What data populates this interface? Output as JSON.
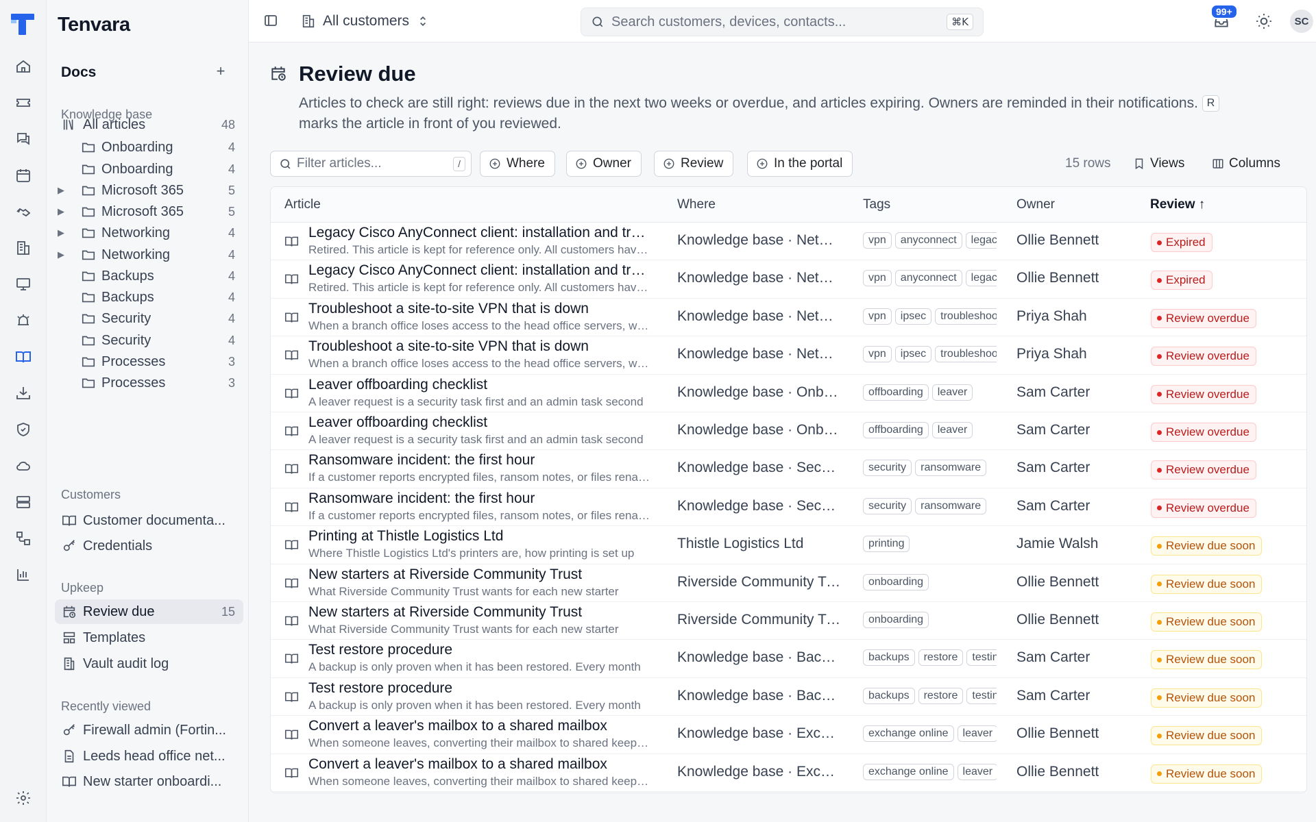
{
  "app": {
    "name": "Tenvara"
  },
  "topbar": {
    "customer_scope": "All customers",
    "search_placeholder": "Search customers, devices, contacts...",
    "search_shortcut": "⌘K",
    "notifications_count": "99+",
    "user_initials": "SC"
  },
  "sidebar": {
    "docs_title": "Docs",
    "sections": {
      "knowledge_base": "Knowledge base",
      "customers": "Customers",
      "upkeep": "Upkeep",
      "recently_viewed": "Recently viewed"
    },
    "kb_items": [
      {
        "label": "All articles",
        "count": "48",
        "icon": "library-icon"
      },
      {
        "label": "Onboarding",
        "count": "4",
        "icon": "folder-icon"
      },
      {
        "label": "Onboarding",
        "count": "4",
        "icon": "folder-icon"
      },
      {
        "label": "Microsoft 365",
        "count": "5",
        "icon": "folder-icon",
        "expandable": true
      },
      {
        "label": "Microsoft 365",
        "count": "5",
        "icon": "folder-icon",
        "expandable": true
      },
      {
        "label": "Networking",
        "count": "4",
        "icon": "folder-icon",
        "expandable": true
      },
      {
        "label": "Networking",
        "count": "4",
        "icon": "folder-icon",
        "expandable": true
      },
      {
        "label": "Backups",
        "count": "4",
        "icon": "folder-icon"
      },
      {
        "label": "Backups",
        "count": "4",
        "icon": "folder-icon"
      },
      {
        "label": "Security",
        "count": "4",
        "icon": "folder-icon"
      },
      {
        "label": "Security",
        "count": "4",
        "icon": "folder-icon"
      },
      {
        "label": "Processes",
        "count": "3",
        "icon": "folder-icon"
      },
      {
        "label": "Processes",
        "count": "3",
        "icon": "folder-icon"
      }
    ],
    "customer_items": [
      {
        "label": "Customer documenta...",
        "icon": "book-icon"
      },
      {
        "label": "Credentials",
        "icon": "key-icon"
      }
    ],
    "upkeep_items": [
      {
        "label": "Review due",
        "count": "15",
        "icon": "calendar-clock-icon",
        "active": true
      },
      {
        "label": "Templates",
        "icon": "template-icon"
      },
      {
        "label": "Vault audit log",
        "icon": "audit-log-icon"
      }
    ],
    "recent_items": [
      {
        "label": "Firewall admin (Fortin...",
        "icon": "key-icon"
      },
      {
        "label": "Leeds head office net...",
        "icon": "file-icon"
      },
      {
        "label": "New starter onboardi...",
        "icon": "book-icon"
      }
    ]
  },
  "page": {
    "title": "Review due",
    "description": "Articles to check are still right: reviews due in the next two weeks or overdue, and articles expiring. Owners are reminded in their notifications.",
    "shortcut_key": "R",
    "shortcut_desc": "marks the article in front of you reviewed."
  },
  "toolbar": {
    "filter_placeholder": "Filter articles...",
    "filter_shortcut": "/",
    "chips": [
      "Where",
      "Owner",
      "Review",
      "In the portal"
    ],
    "rows_count": "15 rows",
    "views_label": "Views",
    "columns_label": "Columns"
  },
  "table": {
    "headers": {
      "article": "Article",
      "where": "Where",
      "tags": "Tags",
      "owner": "Owner",
      "review": "Review ↑"
    },
    "rows": [
      {
        "title": "Legacy Cisco AnyConnect client: installation and troubleshooting",
        "sub": "Retired. This article is kept for reference only. All customers have moved",
        "where": "Knowledge base · Networking",
        "tags": [
          "vpn",
          "anyconnect",
          "legacy"
        ],
        "owner": "Ollie Bennett",
        "status": "Expired",
        "tone": "red"
      },
      {
        "title": "Legacy Cisco AnyConnect client: installation and troubleshooting",
        "sub": "Retired. This article is kept for reference only. All customers have moved",
        "where": "Knowledge base · Networking",
        "tags": [
          "vpn",
          "anyconnect",
          "legacy"
        ],
        "owner": "Ollie Bennett",
        "status": "Expired",
        "tone": "red"
      },
      {
        "title": "Troubleshoot a site-to-site VPN that is down",
        "sub": "When a branch office loses access to the head office servers, work through",
        "where": "Knowledge base · Networking",
        "tags": [
          "vpn",
          "ipsec",
          "troubleshooting"
        ],
        "owner": "Priya Shah",
        "status": "Review overdue",
        "tone": "red"
      },
      {
        "title": "Troubleshoot a site-to-site VPN that is down",
        "sub": "When a branch office loses access to the head office servers, work through",
        "where": "Knowledge base · Networking",
        "tags": [
          "vpn",
          "ipsec",
          "troubleshooting"
        ],
        "owner": "Priya Shah",
        "status": "Review overdue",
        "tone": "red"
      },
      {
        "title": "Leaver offboarding checklist",
        "sub": "A leaver request is a security task first and an admin task second",
        "where": "Knowledge base · Onboarding",
        "tags": [
          "offboarding",
          "leaver"
        ],
        "owner": "Sam Carter",
        "status": "Review overdue",
        "tone": "red"
      },
      {
        "title": "Leaver offboarding checklist",
        "sub": "A leaver request is a security task first and an admin task second",
        "where": "Knowledge base · Onboarding",
        "tags": [
          "offboarding",
          "leaver"
        ],
        "owner": "Sam Carter",
        "status": "Review overdue",
        "tone": "red"
      },
      {
        "title": "Ransomware incident: the first hour",
        "sub": "If a customer reports encrypted files, ransom notes, or files renamed",
        "where": "Knowledge base · Security",
        "tags": [
          "security",
          "ransomware"
        ],
        "owner": "Sam Carter",
        "status": "Review overdue",
        "tone": "red"
      },
      {
        "title": "Ransomware incident: the first hour",
        "sub": "If a customer reports encrypted files, ransom notes, or files renamed",
        "where": "Knowledge base · Security",
        "tags": [
          "security",
          "ransomware"
        ],
        "owner": "Sam Carter",
        "status": "Review overdue",
        "tone": "red"
      },
      {
        "title": "Printing at Thistle Logistics Ltd",
        "sub": "Where Thistle Logistics Ltd's printers are, how printing is set up",
        "where": "Thistle Logistics Ltd",
        "tags": [
          "printing"
        ],
        "owner": "Jamie Walsh",
        "status": "Review due soon",
        "tone": "amber"
      },
      {
        "title": "New starters at Riverside Community Trust",
        "sub": "What Riverside Community Trust wants for each new starter",
        "where": "Riverside Community Trust",
        "tags": [
          "onboarding"
        ],
        "owner": "Ollie Bennett",
        "status": "Review due soon",
        "tone": "amber"
      },
      {
        "title": "New starters at Riverside Community Trust",
        "sub": "What Riverside Community Trust wants for each new starter",
        "where": "Riverside Community Trust",
        "tags": [
          "onboarding"
        ],
        "owner": "Ollie Bennett",
        "status": "Review due soon",
        "tone": "amber"
      },
      {
        "title": "Test restore procedure",
        "sub": "A backup is only proven when it has been restored. Every month",
        "where": "Knowledge base · Backups",
        "tags": [
          "backups",
          "restore",
          "testing"
        ],
        "owner": "Sam Carter",
        "status": "Review due soon",
        "tone": "amber"
      },
      {
        "title": "Test restore procedure",
        "sub": "A backup is only proven when it has been restored. Every month",
        "where": "Knowledge base · Backups",
        "tags": [
          "backups",
          "restore",
          "testing"
        ],
        "owner": "Sam Carter",
        "status": "Review due soon",
        "tone": "amber"
      },
      {
        "title": "Convert a leaver's mailbox to a shared mailbox",
        "sub": "When someone leaves, converting their mailbox to shared keeps the mail",
        "where": "Knowledge base · Exchange Online",
        "tags": [
          "exchange online",
          "leaver"
        ],
        "owner": "Ollie Bennett",
        "status": "Review due soon",
        "tone": "amber"
      },
      {
        "title": "Convert a leaver's mailbox to a shared mailbox",
        "sub": "When someone leaves, converting their mailbox to shared keeps the mail",
        "where": "Knowledge base · Exchange Online",
        "tags": [
          "exchange online",
          "leaver"
        ],
        "owner": "Ollie Bennett",
        "status": "Review due soon",
        "tone": "amber"
      }
    ]
  },
  "colors": {
    "accent": "#2563eb",
    "danger": "#b91c1c",
    "warning": "#b45309"
  }
}
